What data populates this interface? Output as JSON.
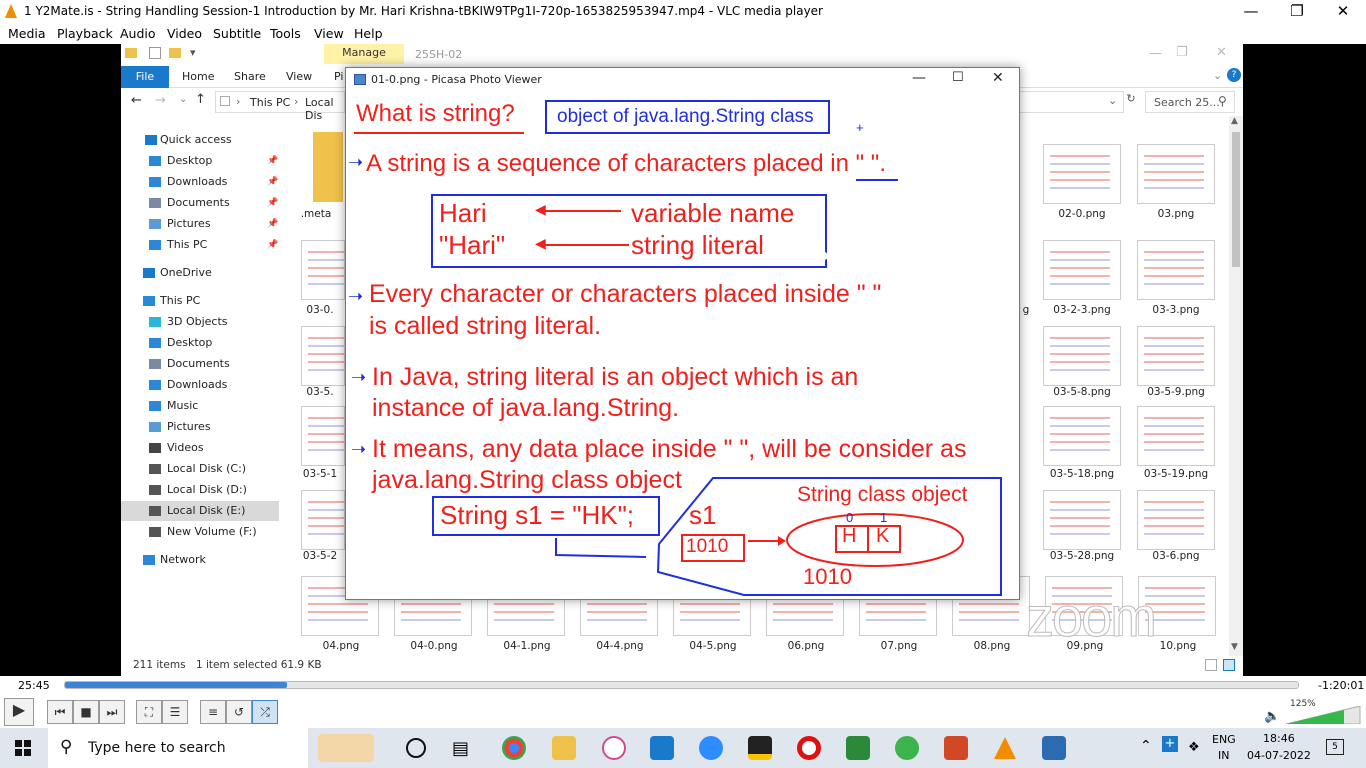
{
  "vlc": {
    "title": "1 Y2Mate.is - String Handling Session-1 Introduction  by Mr. Hari Krishna-tBKIW9TPg1I-720p-1653825953947.mp4 - VLC media player",
    "menu": [
      "Media",
      "Playback",
      "Audio",
      "Video",
      "Subtitle",
      "Tools",
      "View",
      "Help"
    ],
    "time_elapsed": "25:45",
    "time_remaining": "-1:20:01",
    "progress_fraction": 0.18,
    "volume_percent": "125%"
  },
  "explorer": {
    "context_tab": "Manage",
    "folder_name": "25SH-02",
    "ribbon_tabs": [
      "File",
      "Home",
      "Share",
      "View",
      "Pi"
    ],
    "address_segments": [
      "This PC",
      "Local Dis"
    ],
    "search_placeholder": "Search 25...",
    "nav_items": [
      {
        "label": "Quick access",
        "icon": "star-icon",
        "color": "#1979ca"
      },
      {
        "label": "Desktop",
        "icon": "desktop-icon",
        "color": "#2b88d8",
        "pinned": true
      },
      {
        "label": "Downloads",
        "icon": "download-icon",
        "color": "#2b88d8",
        "pinned": true
      },
      {
        "label": "Documents",
        "icon": "documents-icon",
        "color": "#7a8aa0",
        "pinned": true
      },
      {
        "label": "Pictures",
        "icon": "pictures-icon",
        "color": "#5a9bd5",
        "pinned": true
      },
      {
        "label": "This PC",
        "icon": "computer-icon",
        "color": "#2b88d8",
        "pinned": true
      },
      {
        "label": "OneDrive",
        "icon": "cloud-icon",
        "color": "#1979ca"
      },
      {
        "label": "This PC",
        "icon": "computer-icon",
        "color": "#2b88d8"
      },
      {
        "label": "3D Objects",
        "icon": "cube-icon",
        "color": "#2bb5d8"
      },
      {
        "label": "Desktop",
        "icon": "desktop-icon",
        "color": "#2b88d8"
      },
      {
        "label": "Documents",
        "icon": "documents-icon",
        "color": "#7a8aa0"
      },
      {
        "label": "Downloads",
        "icon": "download-icon",
        "color": "#2b88d8"
      },
      {
        "label": "Music",
        "icon": "music-icon",
        "color": "#2b88d8"
      },
      {
        "label": "Pictures",
        "icon": "pictures-icon",
        "color": "#5a9bd5"
      },
      {
        "label": "Videos",
        "icon": "video-icon",
        "color": "#444"
      },
      {
        "label": "Local Disk (C:)",
        "icon": "windows-drive-icon",
        "color": "#555"
      },
      {
        "label": "Local Disk (D:)",
        "icon": "drive-icon",
        "color": "#555"
      },
      {
        "label": "Local Disk (E:)",
        "icon": "drive-icon",
        "color": "#555",
        "selected": true
      },
      {
        "label": "New Volume (F:)",
        "icon": "drive-icon",
        "color": "#555"
      },
      {
        "label": "Network",
        "icon": "network-icon",
        "color": "#2b88d8"
      }
    ],
    "left_labels": [
      ".meta",
      "03-0.",
      "03-5.",
      "03-5-1",
      "03-5-2"
    ],
    "right_labels": [
      [
        "02-0.png",
        "03.png"
      ],
      [
        "03-2-3.png",
        "03-3.png"
      ],
      [
        "03-5-8.png",
        "03-5-9.png"
      ],
      [
        "03-5-18.png",
        "03-5-19.png"
      ],
      [
        "03-5-28.png",
        "03-6.png"
      ]
    ],
    "partial_label": "g",
    "bottom_labels": [
      "04.png",
      "04-0.png",
      "04-1.png",
      "04-4.png",
      "04-5.png",
      "06.png",
      "07.png",
      "08.png",
      "09.png",
      "10.png"
    ],
    "status_count": "211 items",
    "status_selected": "1 item selected  61.9 KB"
  },
  "picasa": {
    "title": "01-0.png - Picasa Photo Viewer",
    "slide": {
      "heading": "What is string?",
      "heading_box": "object of java.lang.String class",
      "plus": "+",
      "p1": "A string is a sequence of characters placed in \" \".",
      "hari": "Hari",
      "hari_quoted": "\"Hari\"",
      "var_name": "variable name",
      "str_literal": "string literal",
      "p2a": "Every character or characters placed inside \" \"",
      "p2b": "is called string literal.",
      "p3a": "In Java, string literal is an object which is an",
      "p3b": "instance of java.lang.String.",
      "p4a": "It means, any data place inside \" \", will be consider as",
      "p4b": "java.lang.String class object",
      "code": "String s1 = \"HK\";",
      "s1": "s1",
      "addr1": "1010",
      "obj_label": "String class object",
      "idx0": "0",
      "idx1": "1",
      "char_h": "H",
      "char_k": "K",
      "addr2": "1010"
    }
  },
  "watermark": "zoom",
  "taskbar": {
    "search_placeholder": "Type here to search",
    "lang_top": "ENG",
    "lang_bottom": "IN",
    "time": "18:46",
    "date": "04-07-2022",
    "notif_count": "5"
  }
}
